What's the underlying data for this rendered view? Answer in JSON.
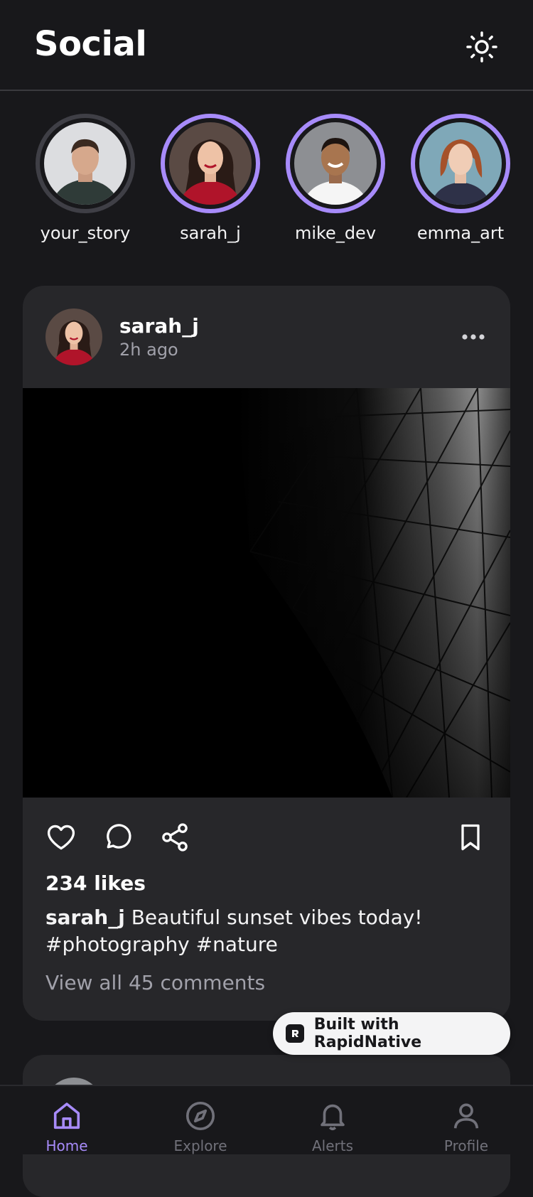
{
  "header": {
    "title": "Social"
  },
  "stories": [
    {
      "name": "your_story",
      "own": true
    },
    {
      "name": "sarah_j",
      "own": false
    },
    {
      "name": "mike_dev",
      "own": false
    },
    {
      "name": "emma_art",
      "own": false
    }
  ],
  "post": {
    "username": "sarah_j",
    "time": "2h ago",
    "likes": "234 likes",
    "caption_user": "sarah_j",
    "caption_text": "Beautiful sunset vibes today! #photography #nature",
    "comments_link": "View all 45 comments"
  },
  "badge": {
    "label": "Built with RapidNative"
  },
  "tabs": [
    {
      "label": "Home",
      "icon": "home-icon",
      "active": true
    },
    {
      "label": "Explore",
      "icon": "compass-icon",
      "active": false
    },
    {
      "label": "Alerts",
      "icon": "bell-icon",
      "active": false
    },
    {
      "label": "Profile",
      "icon": "user-icon",
      "active": false
    }
  ],
  "colors": {
    "background": "#18181b",
    "card": "#27272a",
    "accent": "#a78bfa",
    "muted": "#a1a1aa"
  }
}
